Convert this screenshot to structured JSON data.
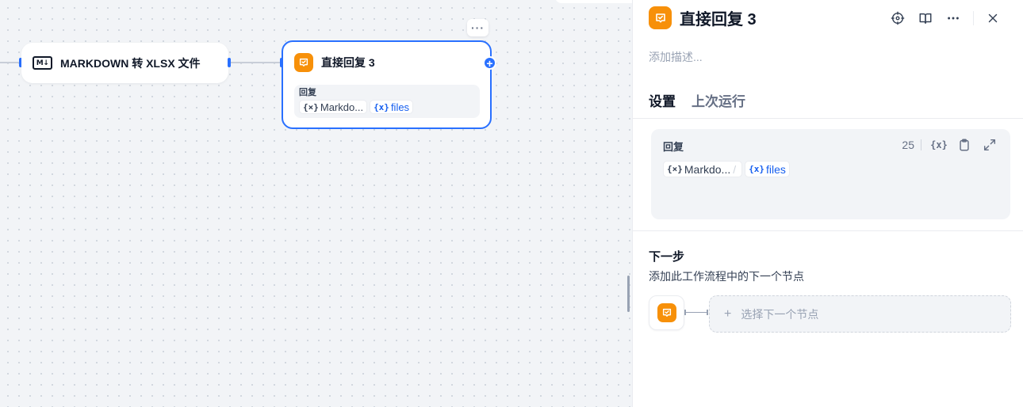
{
  "canvas": {
    "markdown_node": {
      "icon_text": "M↓",
      "title": "MARKDOWN 转 XLSX 文件"
    },
    "answer_node": {
      "title": "直接回复 3",
      "body_label": "回复",
      "chip1_var": "{×}",
      "chip1_text": "Markdo...",
      "chip2_var": "{x}",
      "chip2_text": "files"
    },
    "more_label": "···",
    "add_label": "+"
  },
  "panel": {
    "title": "直接回复 3",
    "description_placeholder": "添加描述...",
    "tabs": [
      {
        "label": "设置",
        "active": true
      },
      {
        "label": "上次运行",
        "active": false
      }
    ],
    "reply": {
      "label": "回复",
      "count": "25",
      "var_label": "{x}",
      "chip1_var": "{×}",
      "chip1_text": "Markdo...",
      "chip2_var": "{x}",
      "chip2_text": "files"
    },
    "next_step": {
      "title": "下一步",
      "description": "添加此工作流程中的下一个节点",
      "select_label": "选择下一个节点",
      "plus": "+"
    }
  },
  "colors": {
    "accent": "#2970ff",
    "node_icon": "#f79009"
  }
}
